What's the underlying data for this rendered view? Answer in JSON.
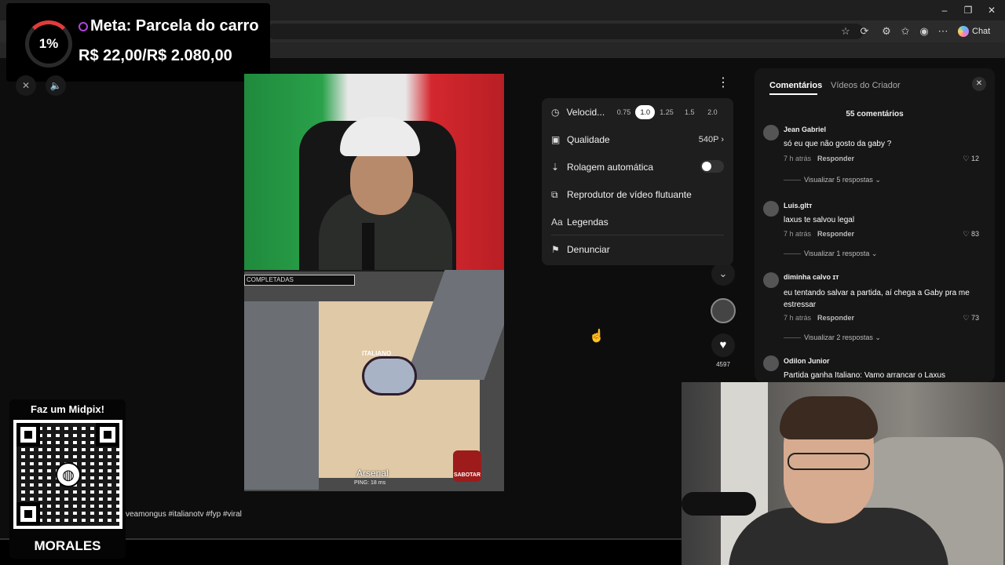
{
  "goal": {
    "percent": "1%",
    "title": "Meta: Parcela do carro",
    "amount": "R$ 22,00/R$ 2.080,00"
  },
  "browser": {
    "chat_label": "Chat",
    "icons": [
      "star-icon",
      "extension-icon",
      "collections-icon",
      "favorites-icon",
      "profile-icon",
      "more-icon"
    ]
  },
  "video": {
    "tasks_label": "COMPLETADAS",
    "player_label": "ITALIANO",
    "map_name": "Arsenal",
    "ping": "PING: 18 ms",
    "sabotage_label": "SABOTAR",
    "hashtags": "veamongus #italianotv #fyp #viral"
  },
  "menu": {
    "speed_label": "Velocid...",
    "speed_options": [
      "0.75",
      "1.0",
      "1.25",
      "1.5",
      "2.0"
    ],
    "speed_selected": "1.0",
    "quality_label": "Qualidade",
    "quality_value": "540P",
    "autoscroll_label": "Rolagem automática",
    "floating_label": "Reprodutor de vídeo flutuante",
    "captions_label": "Legendas",
    "report_label": "Denunciar"
  },
  "rail": {
    "like_count": "4597"
  },
  "comments": {
    "tab_comments": "Comentários",
    "tab_creator": "Vídeos do Criador",
    "count": "55 comentários",
    "items": [
      {
        "user": "Jean Gabriel",
        "text": "só eu que não gosto da gaby ?",
        "time": "7 h atrás",
        "reply": "Responder",
        "likes": "12",
        "thread": "Visualizar 5 respostas"
      },
      {
        "user": "Luis.gItт",
        "text": "laxus te salvou legal",
        "time": "7 h atrás",
        "reply": "Responder",
        "likes": "83",
        "thread": "Visualizar 1 resposta"
      },
      {
        "user": "diminha calvo ɪᴛ",
        "text": "eu tentando salvar a partida, aí chega a Gaby pra me estressar",
        "time": "7 h atrás",
        "reply": "Responder",
        "likes": "73",
        "thread": "Visualizar 2 respostas"
      },
      {
        "user": "Odilon Junior",
        "text": "Partida ganha Italiano: Vamo arrancar o Laxus"
      }
    ]
  },
  "qr": {
    "title": "Faz um Midpix!",
    "brand": "MORALES"
  },
  "colors": {
    "accent_red": "#e23b3b",
    "goal_dot": "#b144d8"
  }
}
